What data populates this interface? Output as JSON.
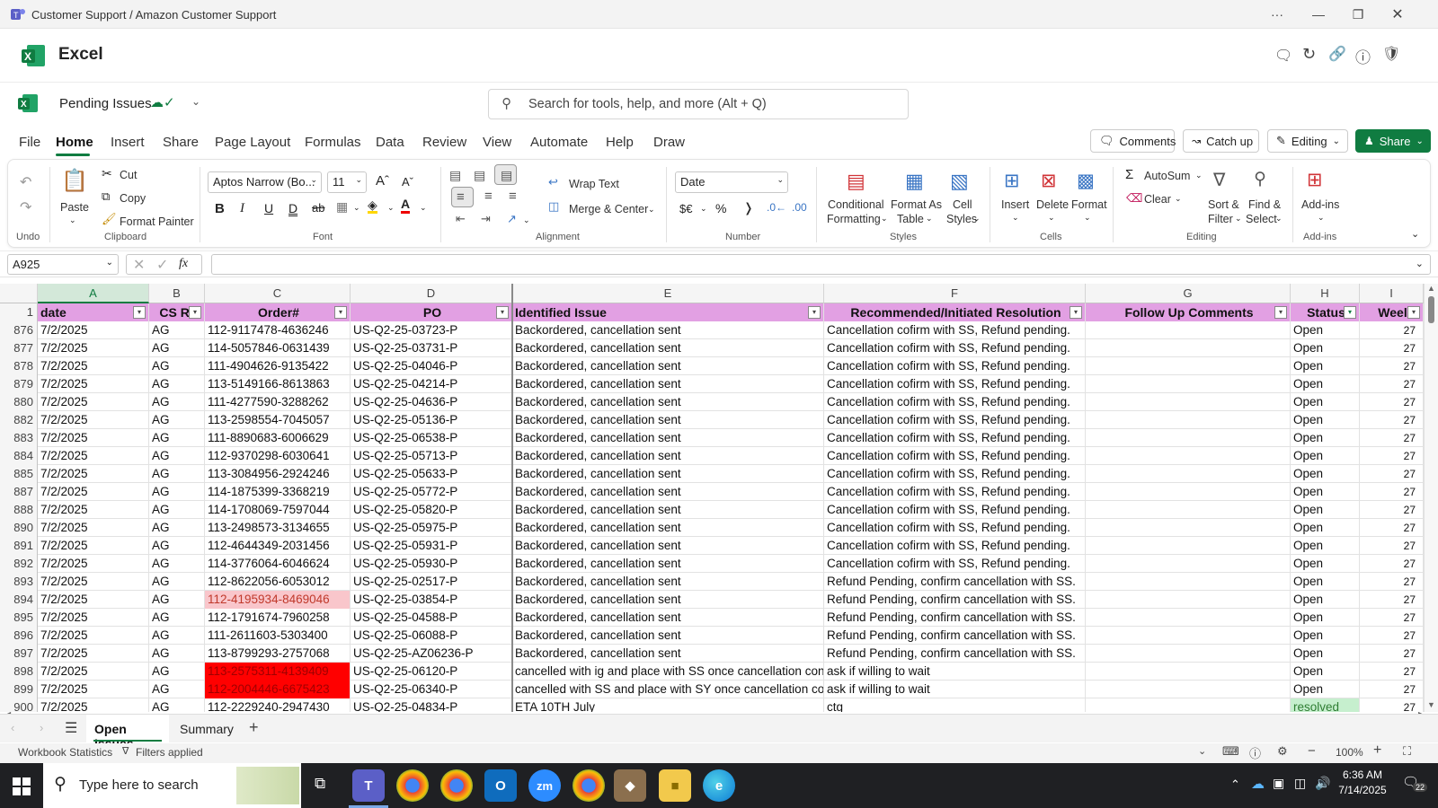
{
  "window": {
    "title": "Customer Support / Amazon Customer Support",
    "more": "···"
  },
  "app": {
    "name": "Excel"
  },
  "doc": {
    "name": "Pending Issues"
  },
  "search": {
    "placeholder": "Search for tools, help, and more (Alt + Q)"
  },
  "menu_tabs": [
    "File",
    "Home",
    "Insert",
    "Share",
    "Page Layout",
    "Formulas",
    "Data",
    "Review",
    "View",
    "Automate",
    "Help",
    "Draw"
  ],
  "top_buttons": {
    "comments": "Comments",
    "catchup": "Catch up",
    "editing": "Editing",
    "share": "Share"
  },
  "ribbon": {
    "undo_group": "Undo",
    "paste": "Paste",
    "cut": "Cut",
    "copy": "Copy",
    "format_painter": "Format Painter",
    "clipboard_group": "Clipboard",
    "font_name": "Aptos Narrow (Bo...",
    "font_size": "11",
    "font_group": "Font",
    "wrap_text": "Wrap Text",
    "merge_center": "Merge & Center",
    "alignment_group": "Alignment",
    "number_format": "Date",
    "number_group": "Number",
    "cond_fmt_1": "Conditional",
    "cond_fmt_2": "Formatting",
    "fmt_table_1": "Format As",
    "fmt_table_2": "Table",
    "cell_styles_1": "Cell",
    "cell_styles_2": "Styles",
    "styles_group": "Styles",
    "insert": "Insert",
    "delete": "Delete",
    "format": "Format",
    "cells_group": "Cells",
    "autosum": "AutoSum",
    "clear": "Clear",
    "sort_1": "Sort &",
    "sort_2": "Filter",
    "find_1": "Find &",
    "find_2": "Select",
    "editing_group": "Editing",
    "addins": "Add-ins",
    "addins_group": "Add-ins"
  },
  "formula_bar": {
    "name_box": "A925",
    "fx": "fx",
    "value": ""
  },
  "columns": [
    "A",
    "B",
    "C",
    "D",
    "E",
    "F",
    "G",
    "H",
    "I"
  ],
  "headers": [
    "date",
    "CS Re",
    "Order#",
    "PO",
    "Identified Issue",
    "Recommended/Initiated Resolution",
    "Follow Up Comments",
    "Status",
    "Weel"
  ],
  "rows": [
    {
      "n": "876",
      "date": "7/2/2025",
      "cs": "AG",
      "order": "112-9117478-4636246",
      "po": "US-Q2-25-03723-P",
      "issue": "Backordered, cancellation sent",
      "res": "Cancellation cofirm with SS, Refund pending.",
      "fu": "",
      "status": "Open",
      "week": "27"
    },
    {
      "n": "877",
      "date": "7/2/2025",
      "cs": "AG",
      "order": "114-5057846-0631439",
      "po": "US-Q2-25-03731-P",
      "issue": "Backordered, cancellation sent",
      "res": "Cancellation cofirm with SS, Refund pending.",
      "fu": "",
      "status": "Open",
      "week": "27"
    },
    {
      "n": "878",
      "date": "7/2/2025",
      "cs": "AG",
      "order": "111-4904626-9135422",
      "po": "US-Q2-25-04046-P",
      "issue": "Backordered, cancellation sent",
      "res": "Cancellation cofirm with SS, Refund pending.",
      "fu": "",
      "status": "Open",
      "week": "27"
    },
    {
      "n": "879",
      "date": "7/2/2025",
      "cs": "AG",
      "order": "113-5149166-8613863",
      "po": "US-Q2-25-04214-P",
      "issue": "Backordered, cancellation sent",
      "res": "Cancellation cofirm with SS, Refund pending.",
      "fu": "",
      "status": "Open",
      "week": "27"
    },
    {
      "n": "880",
      "date": "7/2/2025",
      "cs": "AG",
      "order": "111-4277590-3288262",
      "po": "US-Q2-25-04636-P",
      "issue": "Backordered, cancellation sent",
      "res": "Cancellation cofirm with SS, Refund pending.",
      "fu": "",
      "status": "Open",
      "week": "27"
    },
    {
      "n": "882",
      "date": "7/2/2025",
      "cs": "AG",
      "order": "113-2598554-7045057",
      "po": "US-Q2-25-05136-P",
      "issue": "Backordered, cancellation sent",
      "res": "Cancellation cofirm with SS, Refund pending.",
      "fu": "",
      "status": "Open",
      "week": "27"
    },
    {
      "n": "883",
      "date": "7/2/2025",
      "cs": "AG",
      "order": "111-8890683-6006629",
      "po": "US-Q2-25-06538-P",
      "issue": "Backordered, cancellation sent",
      "res": "Cancellation cofirm with SS, Refund pending.",
      "fu": "",
      "status": "Open",
      "week": "27"
    },
    {
      "n": "884",
      "date": "7/2/2025",
      "cs": "AG",
      "order": "112-9370298-6030641",
      "po": "US-Q2-25-05713-P",
      "issue": "Backordered, cancellation sent",
      "res": "Cancellation cofirm with SS, Refund pending.",
      "fu": "",
      "status": "Open",
      "week": "27"
    },
    {
      "n": "885",
      "date": "7/2/2025",
      "cs": "AG",
      "order": "113-3084956-2924246",
      "po": "US-Q2-25-05633-P",
      "issue": "Backordered, cancellation sent",
      "res": "Cancellation cofirm with SS, Refund pending.",
      "fu": "",
      "status": "Open",
      "week": "27"
    },
    {
      "n": "887",
      "date": "7/2/2025",
      "cs": "AG",
      "order": "114-1875399-3368219",
      "po": "US-Q2-25-05772-P",
      "issue": "Backordered, cancellation sent",
      "res": "Cancellation cofirm with SS, Refund pending.",
      "fu": "",
      "status": "Open",
      "week": "27"
    },
    {
      "n": "888",
      "date": "7/2/2025",
      "cs": "AG",
      "order": "114-1708069-7597044",
      "po": "US-Q2-25-05820-P",
      "issue": "Backordered, cancellation sent",
      "res": "Cancellation cofirm with SS, Refund pending.",
      "fu": "",
      "status": "Open",
      "week": "27"
    },
    {
      "n": "890",
      "date": "7/2/2025",
      "cs": "AG",
      "order": "113-2498573-3134655",
      "po": "US-Q2-25-05975-P",
      "issue": "Backordered, cancellation sent",
      "res": "Cancellation cofirm with SS, Refund pending.",
      "fu": "",
      "status": "Open",
      "week": "27"
    },
    {
      "n": "891",
      "date": "7/2/2025",
      "cs": "AG",
      "order": "112-4644349-2031456",
      "po": "US-Q2-25-05931-P",
      "issue": "Backordered, cancellation sent",
      "res": "Cancellation cofirm with SS, Refund pending.",
      "fu": "",
      "status": "Open",
      "week": "27"
    },
    {
      "n": "892",
      "date": "7/2/2025",
      "cs": "AG",
      "order": "114-3776064-6046624",
      "po": "US-Q2-25-05930-P",
      "issue": "Backordered, cancellation sent",
      "res": "Cancellation cofirm with SS, Refund pending.",
      "fu": "",
      "status": "Open",
      "week": "27"
    },
    {
      "n": "893",
      "date": "7/2/2025",
      "cs": "AG",
      "order": "112-8622056-6053012",
      "po": "US-Q2-25-02517-P",
      "issue": "Backordered, cancellation sent",
      "res": "Refund Pending, confirm cancellation with SS.",
      "fu": "",
      "status": "Open",
      "week": "27"
    },
    {
      "n": "894",
      "date": "7/2/2025",
      "cs": "AG",
      "order": "112-4195934-8469046",
      "po": "US-Q2-25-03854-P",
      "issue": "Backordered, cancellation sent",
      "res": "Refund Pending, confirm cancellation with SS.",
      "fu": "",
      "status": "Open",
      "week": "27",
      "order_fill": "#f9c6cb",
      "order_color": "#c0392b"
    },
    {
      "n": "895",
      "date": "7/2/2025",
      "cs": "AG",
      "order": "112-1791674-7960258",
      "po": "US-Q2-25-04588-P",
      "issue": "Backordered, cancellation sent",
      "res": "Refund Pending, confirm cancellation with SS.",
      "fu": "",
      "status": "Open",
      "week": "27"
    },
    {
      "n": "896",
      "date": "7/2/2025",
      "cs": "AG",
      "order": "111-2611603-5303400",
      "po": "US-Q2-25-06088-P",
      "issue": "Backordered, cancellation sent",
      "res": "Refund Pending, confirm cancellation with SS.",
      "fu": "",
      "status": "Open",
      "week": "27"
    },
    {
      "n": "897",
      "date": "7/2/2025",
      "cs": "AG",
      "order": "113-8799293-2757068",
      "po": "US-Q2-25-AZ06236-P",
      "issue": "Backordered, cancellation sent",
      "res": "Refund Pending, confirm cancellation with SS.",
      "fu": "",
      "status": "Open",
      "week": "27"
    },
    {
      "n": "898",
      "date": "7/2/2025",
      "cs": "AG",
      "order": "113-2575311-4139409",
      "po": "US-Q2-25-06120-P",
      "issue": "cancelled with ig and place with SS once cancellation confi",
      "res": "ask if willing to wait",
      "fu": "",
      "status": "Open",
      "week": "27",
      "order_fill": "#ff0000",
      "order_color": "#a00000"
    },
    {
      "n": "899",
      "date": "7/2/2025",
      "cs": "AG",
      "order": "112-2004446-6675423",
      "po": "US-Q2-25-06340-P",
      "issue": "cancelled with SS and place with SY once cancellation conf",
      "res": "ask if willing to wait",
      "fu": "",
      "status": "Open",
      "week": "27",
      "order_fill": "#ff0000",
      "order_color": "#a00000"
    },
    {
      "n": "900",
      "date": "7/2/2025",
      "cs": "AG",
      "order": "112-2229240-2947430",
      "po": "US-Q2-25-04834-P",
      "issue": "ETA 10TH July",
      "res": "ctg",
      "fu": "",
      "status": "resolved",
      "week": "27",
      "status_fill": "#c6efce",
      "status_color": "#2e7d32"
    }
  ],
  "sheets": {
    "tabs": [
      "Open Issues",
      "Summary"
    ],
    "active": "Open Issues"
  },
  "status": {
    "stats": "Workbook Statistics",
    "filters": "Filters applied",
    "zoom": "100%"
  },
  "taskbar": {
    "search": "Type here to search",
    "time": "6:36 AM",
    "date": "7/14/2025",
    "notif": "22",
    "zoom_app": "zm"
  },
  "colors": {
    "header_fill": "#e2a0e3",
    "excel_green": "#107c41",
    "share_btn": "#107c41"
  }
}
